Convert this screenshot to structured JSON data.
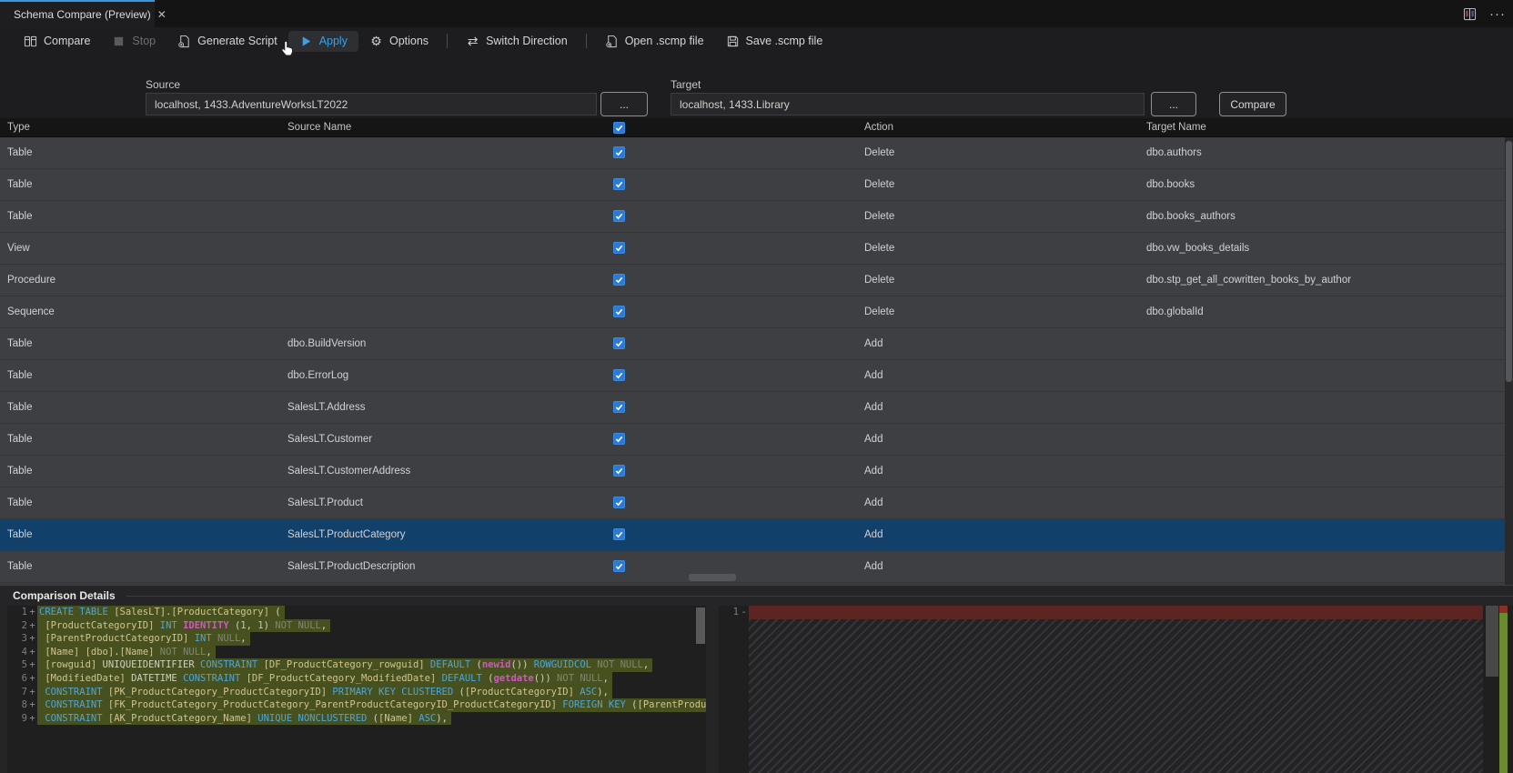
{
  "tab_bar": {
    "title": "Schema Compare (Preview)",
    "close_glyph": "✕",
    "more_glyph": "···"
  },
  "toolbar": {
    "compare": "Compare",
    "stop": "Stop",
    "generate_script": "Generate Script",
    "apply": "Apply",
    "options": "Options",
    "options_glyph": "⚙",
    "switch_direction": "Switch Direction",
    "switch_glyph": "⇄",
    "open_scmp": "Open .scmp file",
    "save_scmp": "Save .scmp file"
  },
  "connection": {
    "source_label": "Source",
    "source_value": "localhost, 1433.AdventureWorksLT2022",
    "target_label": "Target",
    "target_value": "localhost, 1433.Library",
    "browse_label": "...",
    "compare_button": "Compare"
  },
  "grid": {
    "columns": {
      "type": "Type",
      "source": "Source Name",
      "action": "Action",
      "target": "Target Name"
    },
    "select_all_checked": true,
    "rows": [
      {
        "type": "Table",
        "source": "",
        "checked": true,
        "action": "Delete",
        "target": "dbo.authors",
        "selected": false
      },
      {
        "type": "Table",
        "source": "",
        "checked": true,
        "action": "Delete",
        "target": "dbo.books",
        "selected": false
      },
      {
        "type": "Table",
        "source": "",
        "checked": true,
        "action": "Delete",
        "target": "dbo.books_authors",
        "selected": false
      },
      {
        "type": "View",
        "source": "",
        "checked": true,
        "action": "Delete",
        "target": "dbo.vw_books_details",
        "selected": false
      },
      {
        "type": "Procedure",
        "source": "",
        "checked": true,
        "action": "Delete",
        "target": "dbo.stp_get_all_cowritten_books_by_author",
        "selected": false
      },
      {
        "type": "Sequence",
        "source": "",
        "checked": true,
        "action": "Delete",
        "target": "dbo.globalId",
        "selected": false
      },
      {
        "type": "Table",
        "source": "dbo.BuildVersion",
        "checked": true,
        "action": "Add",
        "target": "",
        "selected": false
      },
      {
        "type": "Table",
        "source": "dbo.ErrorLog",
        "checked": true,
        "action": "Add",
        "target": "",
        "selected": false
      },
      {
        "type": "Table",
        "source": "SalesLT.Address",
        "checked": true,
        "action": "Add",
        "target": "",
        "selected": false
      },
      {
        "type": "Table",
        "source": "SalesLT.Customer",
        "checked": true,
        "action": "Add",
        "target": "",
        "selected": false
      },
      {
        "type": "Table",
        "source": "SalesLT.CustomerAddress",
        "checked": true,
        "action": "Add",
        "target": "",
        "selected": false
      },
      {
        "type": "Table",
        "source": "SalesLT.Product",
        "checked": true,
        "action": "Add",
        "target": "",
        "selected": false
      },
      {
        "type": "Table",
        "source": "SalesLT.ProductCategory",
        "checked": true,
        "action": "Add",
        "target": "",
        "selected": true
      },
      {
        "type": "Table",
        "source": "SalesLT.ProductDescription",
        "checked": true,
        "action": "Add",
        "target": "",
        "selected": false
      }
    ]
  },
  "details": {
    "title": "Comparison Details",
    "left_lines": [
      {
        "num": "1",
        "sign": "+",
        "segments": [
          [
            "kw",
            "CREATE TABLE"
          ],
          [
            "pl",
            " "
          ],
          [
            "id",
            "[SalesLT]"
          ],
          [
            "pl",
            "."
          ],
          [
            "id",
            "[ProductCategory]"
          ],
          [
            "pl",
            " ("
          ]
        ]
      },
      {
        "num": "2",
        "sign": "+",
        "segments": [
          [
            "pl",
            " "
          ],
          [
            "id",
            "[ProductCategoryID]"
          ],
          [
            "pl",
            " "
          ],
          [
            "kw",
            "INT"
          ],
          [
            "pl",
            " "
          ],
          [
            "fn",
            "IDENTITY"
          ],
          [
            "pl",
            " ("
          ],
          [
            "num",
            "1"
          ],
          [
            "pl",
            ", "
          ],
          [
            "num",
            "1"
          ],
          [
            "pl",
            ") "
          ],
          [
            "dim",
            "NOT NULL"
          ],
          [
            "pl",
            ","
          ]
        ]
      },
      {
        "num": "3",
        "sign": "+",
        "segments": [
          [
            "pl",
            " "
          ],
          [
            "id",
            "[ParentProductCategoryID]"
          ],
          [
            "pl",
            " "
          ],
          [
            "kw",
            "INT"
          ],
          [
            "pl",
            " "
          ],
          [
            "dim",
            "NULL"
          ],
          [
            "pl",
            ","
          ]
        ]
      },
      {
        "num": "4",
        "sign": "+",
        "segments": [
          [
            "pl",
            " "
          ],
          [
            "id",
            "[Name]"
          ],
          [
            "pl",
            " "
          ],
          [
            "id",
            "[dbo]"
          ],
          [
            "pl",
            "."
          ],
          [
            "id",
            "[Name]"
          ],
          [
            "pl",
            " "
          ],
          [
            "dim",
            "NOT NULL"
          ],
          [
            "pl",
            ","
          ]
        ]
      },
      {
        "num": "5",
        "sign": "+",
        "segments": [
          [
            "pl",
            " "
          ],
          [
            "id",
            "[rowguid]"
          ],
          [
            "pl",
            " UNIQUEIDENTIFIER "
          ],
          [
            "kw",
            "CONSTRAINT"
          ],
          [
            "pl",
            " "
          ],
          [
            "id",
            "[DF_ProductCategory_rowguid]"
          ],
          [
            "pl",
            " "
          ],
          [
            "kw",
            "DEFAULT"
          ],
          [
            "pl",
            " ("
          ],
          [
            "fn",
            "newid"
          ],
          [
            "pl",
            "()) "
          ],
          [
            "kw",
            "ROWGUIDCOL"
          ],
          [
            "pl",
            " "
          ],
          [
            "dim",
            "NOT NULL"
          ],
          [
            "pl",
            ","
          ]
        ]
      },
      {
        "num": "6",
        "sign": "+",
        "segments": [
          [
            "pl",
            " "
          ],
          [
            "id",
            "[ModifiedDate]"
          ],
          [
            "pl",
            " DATETIME "
          ],
          [
            "kw",
            "CONSTRAINT"
          ],
          [
            "pl",
            " "
          ],
          [
            "id",
            "[DF_ProductCategory_ModifiedDate]"
          ],
          [
            "pl",
            " "
          ],
          [
            "kw",
            "DEFAULT"
          ],
          [
            "pl",
            " ("
          ],
          [
            "fn",
            "getdate"
          ],
          [
            "pl",
            "()) "
          ],
          [
            "dim",
            "NOT NULL"
          ],
          [
            "pl",
            ","
          ]
        ]
      },
      {
        "num": "7",
        "sign": "+",
        "segments": [
          [
            "pl",
            " "
          ],
          [
            "kw",
            "CONSTRAINT"
          ],
          [
            "pl",
            " "
          ],
          [
            "id",
            "[PK_ProductCategory_ProductCategoryID]"
          ],
          [
            "pl",
            " "
          ],
          [
            "kw",
            "PRIMARY KEY CLUSTERED"
          ],
          [
            "pl",
            " ("
          ],
          [
            "id",
            "[ProductCategoryID]"
          ],
          [
            "pl",
            " "
          ],
          [
            "kw",
            "ASC"
          ],
          [
            "pl",
            "),"
          ]
        ]
      },
      {
        "num": "8",
        "sign": "+",
        "segments": [
          [
            "pl",
            " "
          ],
          [
            "kw",
            "CONSTRAINT"
          ],
          [
            "pl",
            " "
          ],
          [
            "id",
            "[FK_ProductCategory_ProductCategory_ParentProductCategoryID_ProductCategoryID]"
          ],
          [
            "pl",
            " "
          ],
          [
            "kw",
            "FOREIGN KEY"
          ],
          [
            "pl",
            " ("
          ],
          [
            "id",
            "[ParentProductCatego"
          ]
        ]
      },
      {
        "num": "9",
        "sign": "+",
        "segments": [
          [
            "pl",
            " "
          ],
          [
            "kw",
            "CONSTRAINT"
          ],
          [
            "pl",
            " "
          ],
          [
            "id",
            "[AK_ProductCategory_Name]"
          ],
          [
            "pl",
            " "
          ],
          [
            "kw",
            "UNIQUE NONCLUSTERED"
          ],
          [
            "pl",
            " ("
          ],
          [
            "id",
            "[Name]"
          ],
          [
            "pl",
            " "
          ],
          [
            "kw",
            "ASC"
          ],
          [
            "pl",
            "),"
          ]
        ]
      }
    ],
    "right_lines": [
      {
        "num": "1",
        "sign": "-"
      }
    ]
  },
  "colors": {
    "accent_blue": "#3996dd",
    "checkbox_blue": "#2b7ad4",
    "selection_blue": "#11406b",
    "diff_added_bg": "#47501f",
    "diff_removed_bg": "#5c2521"
  }
}
